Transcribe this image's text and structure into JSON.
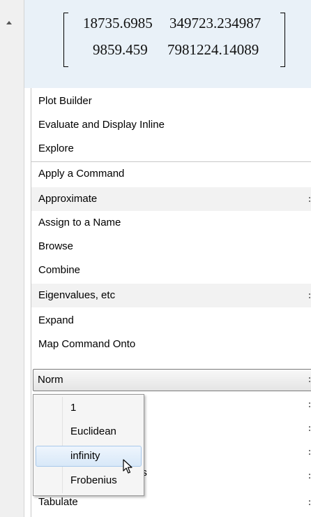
{
  "scrollbar": {
    "up_arrow_icon": "triangle-up-icon"
  },
  "matrix": {
    "rows": [
      [
        "18735.6985",
        "349723.234987"
      ],
      [
        "9859.459",
        "7981224.14089"
      ]
    ]
  },
  "menu": {
    "items": [
      {
        "label": "Plot Builder"
      },
      {
        "label": "Evaluate and Display Inline"
      },
      {
        "label": "Explore"
      },
      {
        "label": "Apply a Command"
      },
      {
        "label": "Approximate"
      },
      {
        "label": "Assign to a Name"
      },
      {
        "label": "Browse"
      },
      {
        "label": "Combine"
      },
      {
        "label": "Eigenvalues, etc"
      },
      {
        "label": "Expand"
      },
      {
        "label": "Map Command Onto"
      },
      {
        "label": "Norm"
      },
      {
        "label": "ns"
      },
      {
        "label": "Tabulate"
      }
    ]
  },
  "submenu": {
    "items": [
      "1",
      "Euclidean",
      "infinity",
      "Frobenius"
    ],
    "highlighted": "infinity"
  },
  "cursor": {
    "icon": "arrow-pointer-icon"
  }
}
